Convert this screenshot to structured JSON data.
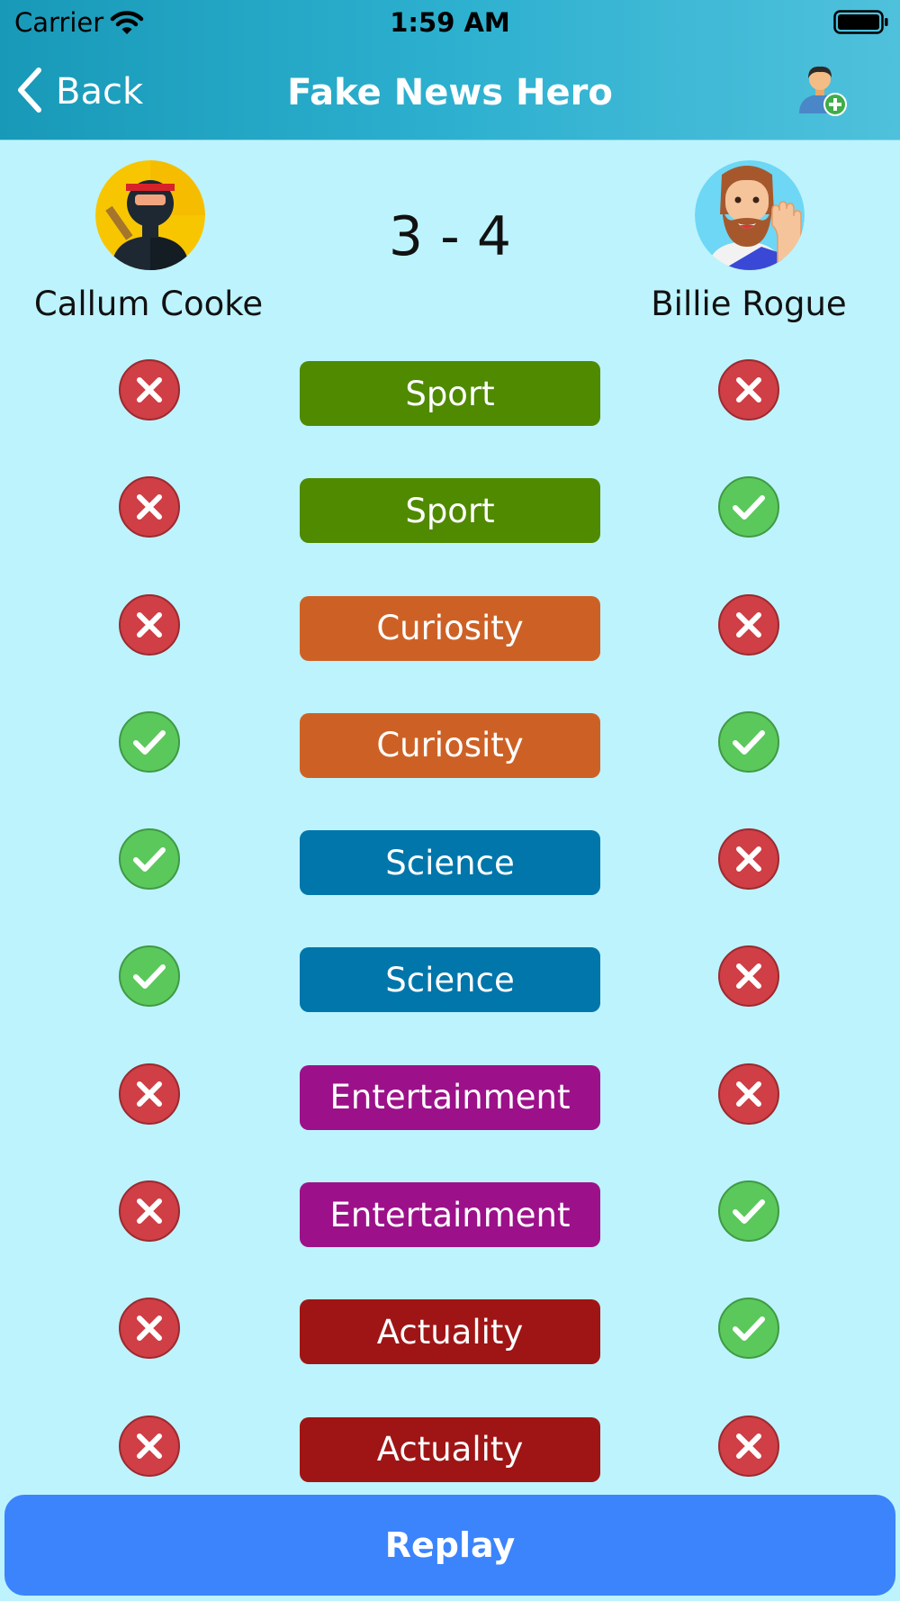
{
  "status_bar": {
    "carrier": "Carrier",
    "time": "1:59 AM",
    "wifi_icon": "wifi-icon",
    "battery_icon": "battery-icon"
  },
  "nav": {
    "back_label": "Back",
    "title": "Fake News Hero",
    "add_user_icon": "add-user-icon"
  },
  "match": {
    "score": "3 - 4",
    "player_left": {
      "name": "Callum Cooke",
      "avatar": "ninja-avatar"
    },
    "player_right": {
      "name": "Billie Rogue",
      "avatar": "bearded-man-avatar"
    }
  },
  "colors": {
    "correct": "#5bc85c",
    "wrong": "#cf3f45",
    "Sport": "#4f8a00",
    "Curiosity": "#cd6125",
    "Science": "#0076ab",
    "Entertainment": "#9c1189",
    "Actuality": "#9f1515"
  },
  "rounds": [
    {
      "category": "Sport",
      "left": "wrong",
      "right": "wrong"
    },
    {
      "category": "Sport",
      "left": "wrong",
      "right": "correct"
    },
    {
      "category": "Curiosity",
      "left": "wrong",
      "right": "wrong"
    },
    {
      "category": "Curiosity",
      "left": "correct",
      "right": "correct"
    },
    {
      "category": "Science",
      "left": "correct",
      "right": "wrong"
    },
    {
      "category": "Science",
      "left": "correct",
      "right": "wrong"
    },
    {
      "category": "Entertainment",
      "left": "wrong",
      "right": "wrong"
    },
    {
      "category": "Entertainment",
      "left": "wrong",
      "right": "correct"
    },
    {
      "category": "Actuality",
      "left": "wrong",
      "right": "correct"
    },
    {
      "category": "Actuality",
      "left": "wrong",
      "right": "wrong"
    }
  ],
  "actions": {
    "replay_label": "Replay"
  }
}
